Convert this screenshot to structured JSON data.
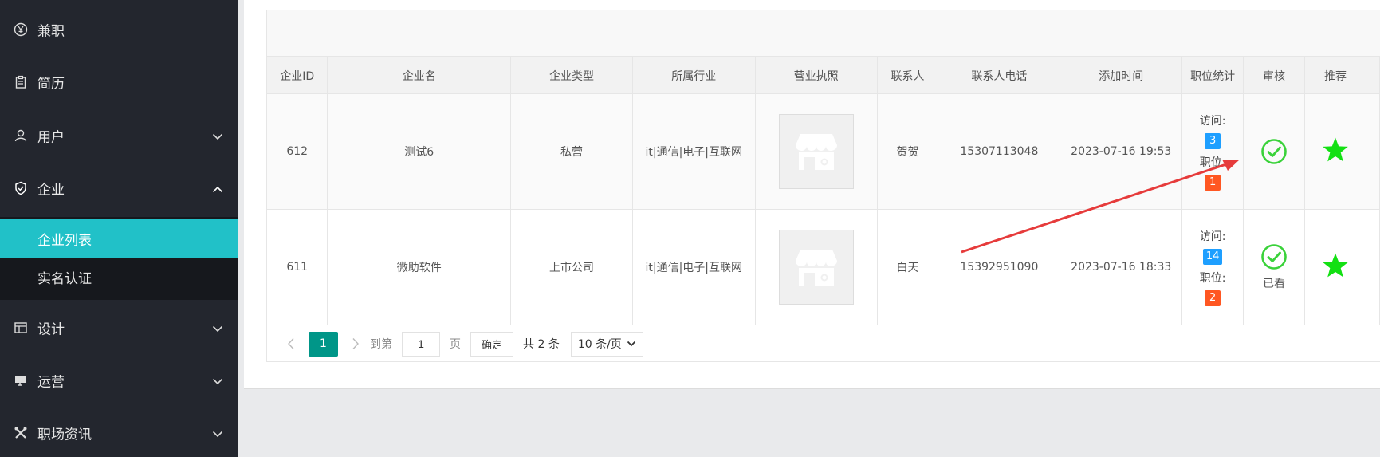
{
  "sidebar": {
    "items": [
      {
        "label": "兼职",
        "icon": "yen-icon"
      },
      {
        "label": "简历",
        "icon": "clipboard-icon"
      },
      {
        "label": "用户",
        "icon": "user-icon"
      },
      {
        "label": "企业",
        "icon": "shield-check-icon"
      },
      {
        "label": "设计",
        "icon": "layout-icon"
      },
      {
        "label": "运营",
        "icon": "megaphone-icon"
      },
      {
        "label": "职场资讯",
        "icon": "tools-icon"
      }
    ],
    "submenu": [
      {
        "label": "企业列表",
        "active": true
      },
      {
        "label": "实名认证",
        "active": false
      }
    ]
  },
  "table": {
    "headers": [
      "企业ID",
      "企业名",
      "企业类型",
      "所属行业",
      "营业执照",
      "联系人",
      "联系人电话",
      "添加时间",
      "职位统计",
      "审核",
      "推荐"
    ],
    "rows": [
      {
        "id": "612",
        "name": "测试6",
        "type": "私营",
        "industry": "it|通信|电子|互联网",
        "contact": "贺贺",
        "phone": "15307113048",
        "time": "2023-07-16 19:53",
        "visit_label": "访问:",
        "visit": "3",
        "job_label": "职位:",
        "jobs": "1",
        "audit_note": ""
      },
      {
        "id": "611",
        "name": "微助软件",
        "type": "上市公司",
        "industry": "it|通信|电子|互联网",
        "contact": "白天",
        "phone": "15392951090",
        "time": "2023-07-16 18:33",
        "visit_label": "访问:",
        "visit": "14",
        "job_label": "职位:",
        "jobs": "2",
        "audit_note": "已看"
      }
    ]
  },
  "pager": {
    "current": "1",
    "goto_label": "到第",
    "goto_value": "1",
    "page_label": "页",
    "confirm": "确定",
    "total": "共 2 条",
    "per_page": "10 条/页"
  },
  "colors": {
    "accent": "#21c1c8",
    "check": "#3ad23a",
    "star": "#13e013",
    "annotation": "#e63b3b"
  }
}
